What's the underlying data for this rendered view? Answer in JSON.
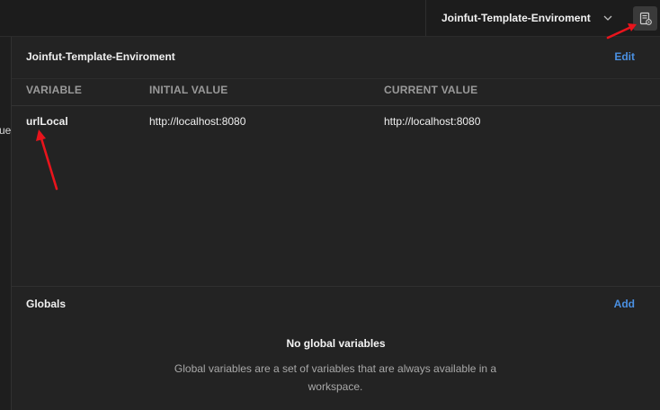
{
  "topbar": {
    "environment_name": "Joinfut-Template-Enviroment",
    "environment_dropdown_icon": "chevron-down-icon",
    "quick_look_icon": "environment-quick-look-icon"
  },
  "background": {
    "peek_text": "ue"
  },
  "environment_panel": {
    "title": "Joinfut-Template-Enviroment",
    "edit_label": "Edit",
    "columns": [
      "VARIABLE",
      "INITIAL VALUE",
      "CURRENT VALUE"
    ],
    "rows": [
      {
        "variable": "urlLocal",
        "initial_value": "http://localhost:8080",
        "current_value": "http://localhost:8080"
      }
    ]
  },
  "globals": {
    "title": "Globals",
    "add_label": "Add",
    "empty_title": "No global variables",
    "empty_description": "Global variables are a set of variables that are always available in a workspace."
  },
  "colors": {
    "accent_link": "#4a90e2",
    "annotation_arrow": "#e8141c"
  }
}
